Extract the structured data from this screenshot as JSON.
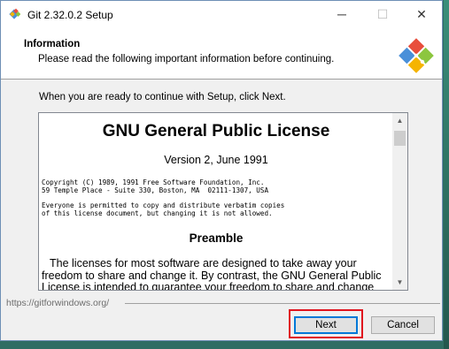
{
  "window": {
    "title": "Git 2.32.0.2 Setup",
    "minimize_glyph": "─",
    "maximize_glyph": "☐",
    "close_glyph": "✕"
  },
  "header": {
    "title": "Information",
    "subtitle": "Please read the following important information before continuing."
  },
  "main": {
    "intro": "When you are ready to continue with Setup, click Next.",
    "license": {
      "title": "GNU General Public License",
      "version": "Version 2, June 1991",
      "copyright_line1": "Copyright (C) 1989, 1991 Free Software Foundation, Inc.",
      "copyright_line2": "59 Temple Place - Suite 330, Boston, MA  02111-1307, USA",
      "permission_line1": "Everyone is permitted to copy and distribute verbatim copies",
      "permission_line2": "of this license document, but changing it is not allowed.",
      "preamble_heading": "Preamble",
      "para_line1": "The licenses for most software are designed to take away your",
      "para_line2": "freedom to share and change it. By contrast, the GNU General Public",
      "para_line3": "License is intended to guarantee your freedom to share and change"
    }
  },
  "footer": {
    "link": "https://gitforwindows.org/",
    "next_label": "Next",
    "cancel_label": "Cancel"
  },
  "colors": {
    "accent_focus": "#0078d7",
    "highlight_box": "#e0141e",
    "desktop": "#2f6d63"
  },
  "icons": {
    "app": "git-diamond-icon",
    "logo": "git-for-windows-logo",
    "scroll_up": "scroll-up-arrow-icon",
    "scroll_down": "scroll-down-arrow-icon"
  }
}
